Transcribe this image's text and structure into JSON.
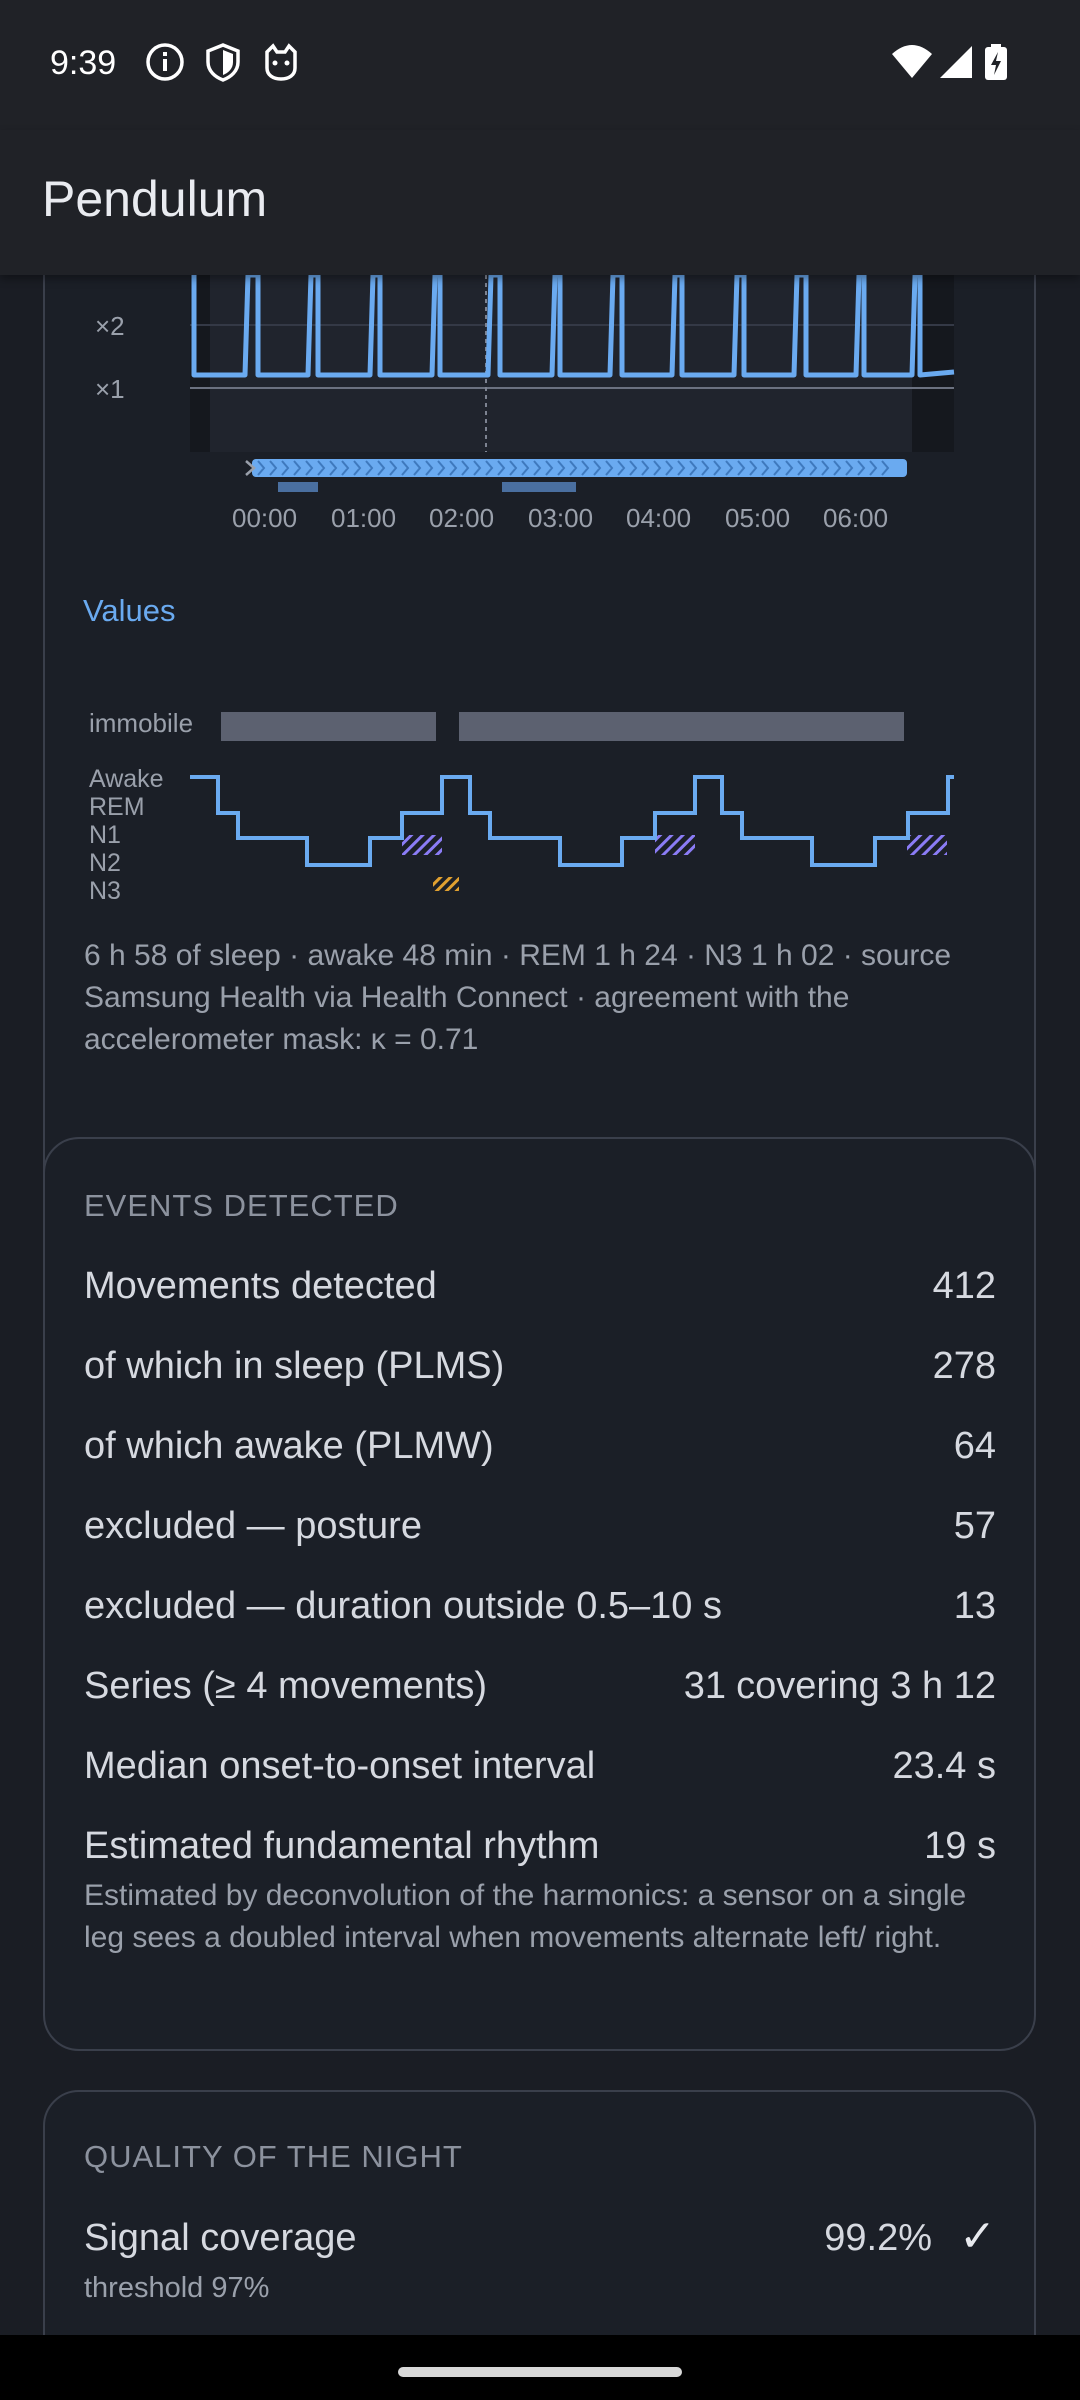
{
  "status_bar": {
    "time": "9:39",
    "icons": [
      "info-icon",
      "shield-icon",
      "cat-icon",
      "wifi-icon",
      "signal-icon",
      "battery-charging-icon"
    ]
  },
  "app": {
    "title": "Pendulum"
  },
  "chart_top": {
    "y_tick_labels": [
      "×2",
      "×1"
    ],
    "x_tick_labels": [
      "00:00",
      "01:00",
      "02:00",
      "03:00",
      "04:00",
      "05:00",
      "06:00"
    ]
  },
  "values_label": "Values",
  "hypnogram": {
    "immobile_label": "immobile",
    "stage_labels": [
      "Awake",
      "REM",
      "N1",
      "N2",
      "N3"
    ]
  },
  "summary_text": "6 h 58 of sleep · awake 48 min · REM 1 h 24 · N3 1 h 02 · source Samsung Health via Health Connect · agreement with the accelerometer mask: κ = 0.71",
  "events": {
    "heading": "EVENTS DETECTED",
    "rows": [
      {
        "label": "Movements detected",
        "value": "412"
      },
      {
        "label": "of which in sleep (PLMS)",
        "value": "278"
      },
      {
        "label": "of which awake (PLMW)",
        "value": "64"
      },
      {
        "label": "excluded — posture",
        "value": "57"
      },
      {
        "label": "excluded — duration outside 0.5–10 s",
        "value": "13"
      },
      {
        "label": "Series (≥ 4 movements)",
        "value": "31",
        "extra": "covering 3 h 12"
      },
      {
        "label": "Median onset-to-onset interval",
        "value": "23.4 s"
      },
      {
        "label": "Estimated fundamental rhythm",
        "value": "19 s"
      }
    ],
    "note": "Estimated by deconvolution of the harmonics: a sensor on a single leg sees a doubled interval when movements alternate left/ right."
  },
  "quality": {
    "heading": "QUALITY OF THE NIGHT",
    "signal_label": "Signal coverage",
    "signal_value": "99.2%",
    "threshold": "threshold 97%",
    "check": "✓"
  },
  "colors": {
    "accent": "#6aaaf0",
    "background": "#1a1d24",
    "card_border": "#3a3f4b",
    "rem_hatch": "#8b7cf6",
    "marker": "#e0a030"
  }
}
